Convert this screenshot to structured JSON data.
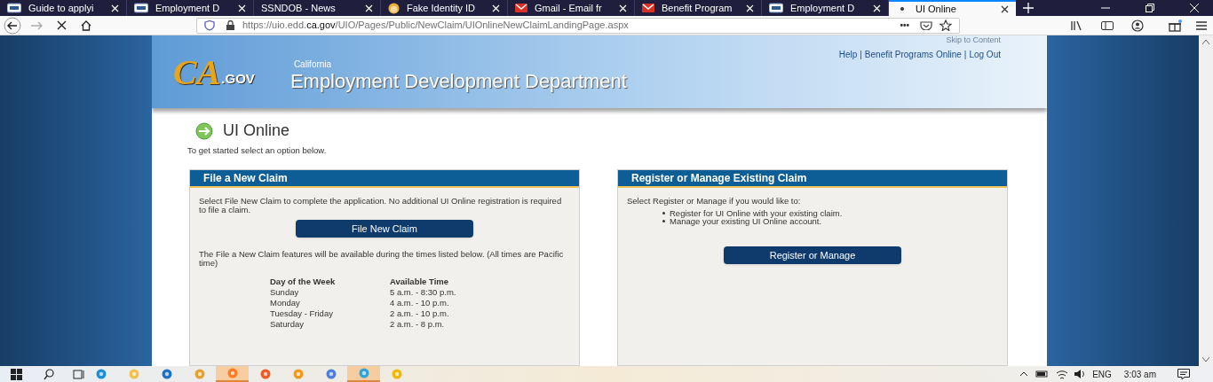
{
  "browser": {
    "tabs": [
      {
        "label": "Guide to applyi",
        "kind": "edd",
        "selected": false
      },
      {
        "label": "Employment D",
        "kind": "edd",
        "selected": false
      },
      {
        "label": "SSNDOB - News",
        "kind": "plain",
        "selected": false
      },
      {
        "label": "Fake Identity ID",
        "kind": "face",
        "selected": false
      },
      {
        "label": "Gmail - Email fr",
        "kind": "mail",
        "selected": false
      },
      {
        "label": "Benefit Program",
        "kind": "mail",
        "selected": false
      },
      {
        "label": "Employment D",
        "kind": "edd",
        "selected": false
      },
      {
        "label": "UI Online",
        "kind": "loading",
        "selected": true
      }
    ],
    "address": {
      "url": "https://uio.edd.**ca.gov**/UIO/Pages/Public/NewClaim/UIOnlineNewClaimLandingPage.aspx",
      "more": "•••"
    }
  },
  "page": {
    "skip_link": "Skip to Content",
    "top_links": [
      "Help",
      "Benefit Programs Online",
      "Log Out"
    ],
    "separator": "|",
    "logo": {
      "main": "CA",
      "suffix": ".GOV"
    },
    "subtitle": "California",
    "title": "Employment Development Department",
    "heading": "UI Online",
    "intro": "To get started select an option below.",
    "panels": [
      {
        "title": "File a New Claim",
        "description": "Select File New Claim to complete the application. No additional UI Online registration is required to file a claim.",
        "button": "File New Claim",
        "note": "The File a New Claim features will be available during the times listed below. (All times are Pacific time)",
        "schedule": {
          "columns": [
            "Day of the Week",
            "Available Time"
          ],
          "rows": [
            [
              "Sunday",
              "5 a.m. - 8:30 p.m."
            ],
            [
              "Monday",
              "4 a.m. - 10 p.m."
            ],
            [
              "Tuesday - Friday",
              "2 a.m. - 10 p.m."
            ],
            [
              "Saturday",
              "2 a.m. - 8 p.m."
            ]
          ]
        }
      },
      {
        "title": "Register or Manage Existing Claim",
        "description": "Select Register or Manage if you would like to:",
        "bullets": [
          "Register for UI Online with your existing claim.",
          "Manage your existing UI Online account."
        ],
        "button": "Register or Manage"
      }
    ]
  },
  "taskbar": {
    "apps": [
      {
        "kind": "edge",
        "active": false
      },
      {
        "kind": "explorer",
        "active": false
      },
      {
        "kind": "mail",
        "active": false
      },
      {
        "kind": "chrome",
        "active": false
      },
      {
        "kind": "firefox",
        "active": true
      },
      {
        "kind": "brave",
        "active": false
      },
      {
        "kind": "orange",
        "active": false
      },
      {
        "kind": "blue",
        "active": false
      },
      {
        "kind": "telegram",
        "active": true
      },
      {
        "kind": "yellow",
        "active": false
      }
    ],
    "language": "ENG",
    "time": "3:03 am"
  }
}
